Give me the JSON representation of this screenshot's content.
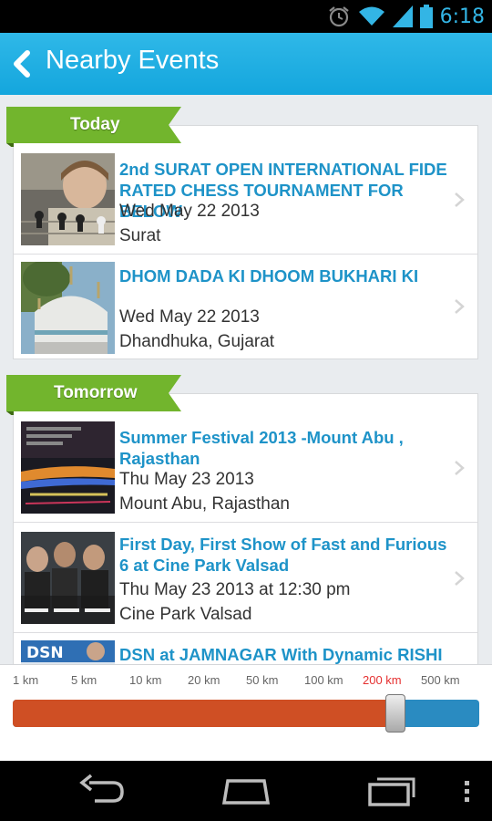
{
  "status_bar": {
    "time": "6:18",
    "icons": [
      "alarm-icon",
      "wifi-icon",
      "signal-icon",
      "battery-icon"
    ]
  },
  "action_bar": {
    "title": "Nearby Events",
    "back_icon": "chevron-left-icon"
  },
  "colors": {
    "accent": "#1e93c8",
    "action_bar": "#1aaee3",
    "tag_green": "#72b52d",
    "slider_fill": "#cf4f24",
    "slider_track": "#2a8bc1",
    "selected_label": "#e53030"
  },
  "sections": [
    {
      "label": "Today",
      "events": [
        {
          "title": "2nd SURAT OPEN INTERNATIONAL FIDE RATED CHESS TOURNAMENT FOR BELOW",
          "date": "Wed May 22 2013",
          "place": "Surat",
          "image": "chess-player-photo"
        },
        {
          "title": "DHOM DADA KI DHOOM BUKHARI KI",
          "date": "Wed May 22 2013",
          "place": "Dhandhuka, Gujarat",
          "image": "mosque-photo"
        }
      ]
    },
    {
      "label": "Tomorrow",
      "events": [
        {
          "title": "Summer Festival 2013 -Mount Abu , Rajasthan",
          "date": "Thu May 23 2013",
          "place": "Mount Abu, Rajasthan",
          "image": "festival-lake-photo"
        },
        {
          "title": "First Day, First Show of Fast and Furious 6 at Cine Park Valsad",
          "date": "Thu May 23 2013 at 12:30 pm",
          "place": "Cine Park Valsad",
          "image": "movie-poster-photo"
        },
        {
          "title": "DSN at JAMNAGAR With Dynamic RISHI",
          "date": "",
          "place": "",
          "image": "dsn-logo-photo"
        }
      ]
    }
  ],
  "distance_slider": {
    "labels": [
      "1 km",
      "5 km",
      "10 km",
      "20 km",
      "50 km",
      "100 km",
      "200 km",
      "500 km"
    ],
    "selected": "200 km",
    "fraction": 0.82
  },
  "nav_bar": {
    "buttons": [
      "back-icon",
      "home-icon",
      "recent-apps-icon",
      "overflow-menu-icon"
    ]
  }
}
